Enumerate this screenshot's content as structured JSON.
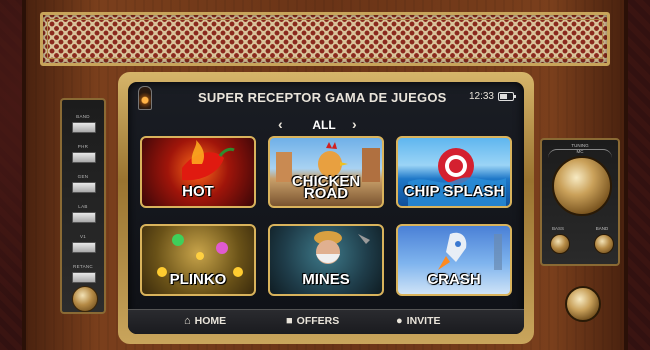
{
  "header": {
    "title": "SUPER RECEPTOR GAMA DE JUEGOS",
    "time": "12:33",
    "battery_level": 0.6
  },
  "category": {
    "label": "ALL",
    "prev_icon": "chevron-left-icon",
    "next_icon": "chevron-right-icon"
  },
  "games": [
    {
      "name": "HOT"
    },
    {
      "name": "CHICKEN ROAD"
    },
    {
      "name": "CHIP SPLASH"
    },
    {
      "name": "PLINKO"
    },
    {
      "name": "MINES"
    },
    {
      "name": "CRASH"
    }
  ],
  "nav": {
    "home": {
      "label": "HOME",
      "icon": "home-icon"
    },
    "offers": {
      "label": "OFFERS",
      "icon": "gift-icon"
    },
    "invite": {
      "label": "INVITE",
      "icon": "user-plus-icon"
    }
  },
  "left_panel": {
    "labels": [
      "BAND",
      "PHR",
      "GEN",
      "LAB",
      "V1",
      "RETANC"
    ]
  },
  "right_panel": {
    "dial_label": "TUNING",
    "scale": "MC",
    "knob_labels": [
      "BASS",
      "BAND"
    ]
  },
  "colors": {
    "frame_gold": "#d9b35c",
    "screen_bg": "#14161c",
    "wood": "#6a3417"
  }
}
